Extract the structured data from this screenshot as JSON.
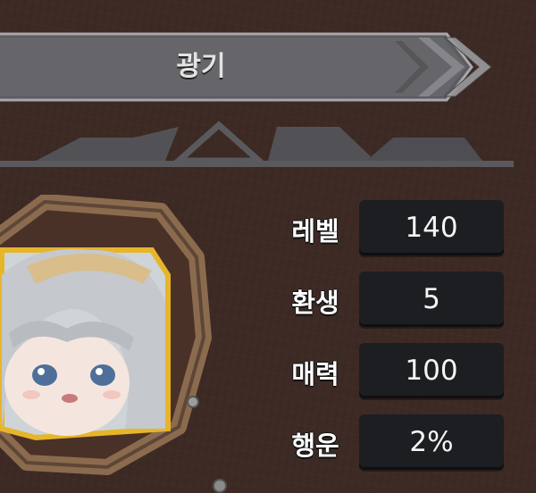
{
  "header": {
    "title": "광기"
  },
  "stats": [
    {
      "label": "레벨",
      "value": "140"
    },
    {
      "label": "환생",
      "value": "5"
    },
    {
      "label": "매력",
      "value": "100"
    },
    {
      "label": "행운",
      "value": "2%"
    }
  ],
  "icons": {
    "header_gem": "blue-gem-icon",
    "header_arrow": "double-chevron-right-icon",
    "portrait": "character-portrait"
  },
  "colors": {
    "background": "#3d2a24",
    "banner": "#6a6a6e",
    "frame_wood": "#8b6b4e",
    "portrait_border": "#e6b52a",
    "value_box": "#1d1e22"
  }
}
